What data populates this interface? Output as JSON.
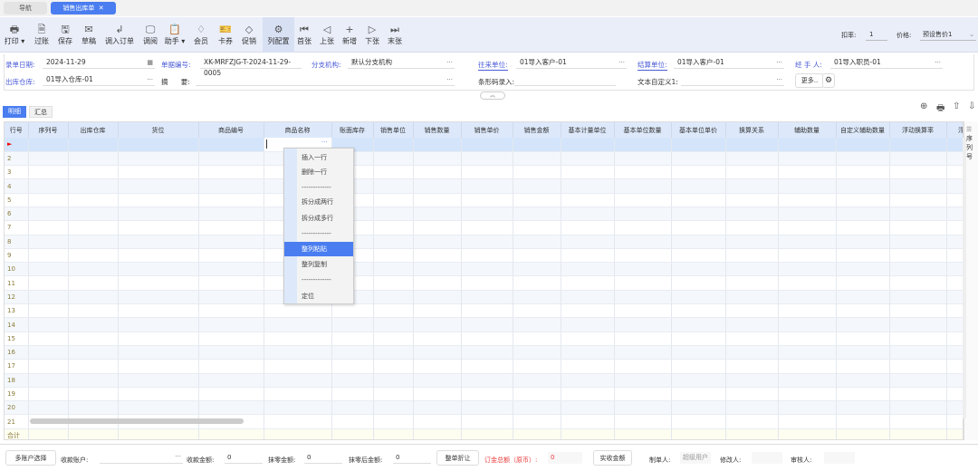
{
  "tabs": [
    {
      "label": "导航"
    },
    {
      "label": "销售出库单",
      "close": "✕"
    }
  ],
  "toolbar": {
    "items": [
      {
        "label": "打印 ▾",
        "icon": "🖶",
        "name": "printer-icon"
      },
      {
        "label": "过账",
        "icon": "🗎",
        "name": "post-icon"
      },
      {
        "label": "保存",
        "icon": "🖫",
        "name": "save-icon"
      },
      {
        "label": "草稿",
        "icon": "✉",
        "name": "draft-icon"
      },
      {
        "label": "调入订单",
        "icon": "↲",
        "name": "import-icon"
      },
      {
        "label": "调阅",
        "icon": "🖵",
        "name": "view-icon"
      },
      {
        "label": "助手 ▾",
        "icon": "📋",
        "name": "clipboard-icon"
      },
      {
        "label": "会员",
        "icon": "♢",
        "name": "diamond-icon"
      },
      {
        "label": "卡券",
        "icon": "🎫",
        "name": "ticket-icon"
      },
      {
        "label": "促销",
        "icon": "◇",
        "name": "tag-icon"
      },
      {
        "label": "列配置",
        "icon": "⚙",
        "name": "gear-icon"
      },
      {
        "label": "首张",
        "icon": "⏮",
        "name": "first-icon"
      },
      {
        "label": "上张",
        "icon": "◁",
        "name": "prev-icon"
      },
      {
        "label": "新增",
        "icon": "+",
        "name": "plus-icon"
      },
      {
        "label": "下张",
        "icon": "▷",
        "name": "next-icon"
      },
      {
        "label": "末张",
        "icon": "⏭",
        "name": "last-icon"
      }
    ],
    "discount_label": "扣率:",
    "discount_value": "1",
    "price_label": "价格:",
    "price_value": "预设售价1"
  },
  "form": {
    "date_label": "录单日期:",
    "date_value": "2024-11-29",
    "no_label": "单据编号:",
    "no_value": "XK-MRFZJG-T-2024-11-29-0005",
    "branch_label": "分支机构:",
    "branch_value": "默认分支机构",
    "partner_label": "往来单位:",
    "partner_value": "01导入客户-01",
    "settle_label": "结算单位:",
    "settle_value": "01导入客户-01",
    "handler_label": "经 手 人:",
    "handler_value": "01导入职员-01",
    "warehouse_label": "出库仓库:",
    "warehouse_value": "01导入仓库-01",
    "summary_label": "摘      要:",
    "summary_value": "",
    "barcode_label": "条形码录入:",
    "barcode_value": "",
    "custom_label": "文本自定义1:",
    "custom_value": "",
    "more_label": "更多.."
  },
  "subtabs": [
    "明细",
    "汇总"
  ],
  "grid": {
    "columns": [
      "行号",
      "序列号",
      "出库仓库",
      "货位",
      "商品编号",
      "商品名称",
      "账面库存",
      "销售单位",
      "销售数量",
      "销售单价",
      "销售金额",
      "基本计量单位",
      "基本单位数量",
      "基本单位单价",
      "换算关系",
      "辅助数量",
      "自定义辅助数量",
      "浮动换算率",
      "浮动"
    ],
    "rows": [
      "1",
      "2",
      "3",
      "4",
      "5",
      "6",
      "7",
      "8",
      "9",
      "10",
      "11",
      "12",
      "13",
      "14",
      "15",
      "16",
      "17",
      "18",
      "19",
      "20",
      "21"
    ],
    "total_label": "合计",
    "side_label": "序列号"
  },
  "context_menu": [
    "插入一行",
    "删除一行",
    "-------------",
    "拆分成两行",
    "拆分成多行",
    "-------------",
    "整列粘贴",
    "整列复制",
    "-------------",
    "定位"
  ],
  "footer": {
    "multi_account": "多账户选择",
    "account_label": "收款账户:",
    "received_label": "收款金额:",
    "received_value": "0",
    "wipe_label": "抹零金额:",
    "wipe_value": "0",
    "after_wipe_label": "抹零后金额:",
    "after_wipe_value": "0",
    "discount_btn": "整单折让",
    "total_label": "订金总额（原币）:",
    "total_value": "0",
    "actual_btn": "实收金额",
    "creator_label": "制单人:",
    "creator_value": "超级用户",
    "modifier_label": "修改人:",
    "auditor_label": "审核人:"
  },
  "colors": {
    "accent": "#4a7df0",
    "label_blue": "#4a5bd8",
    "warning": "#e83a3a"
  }
}
